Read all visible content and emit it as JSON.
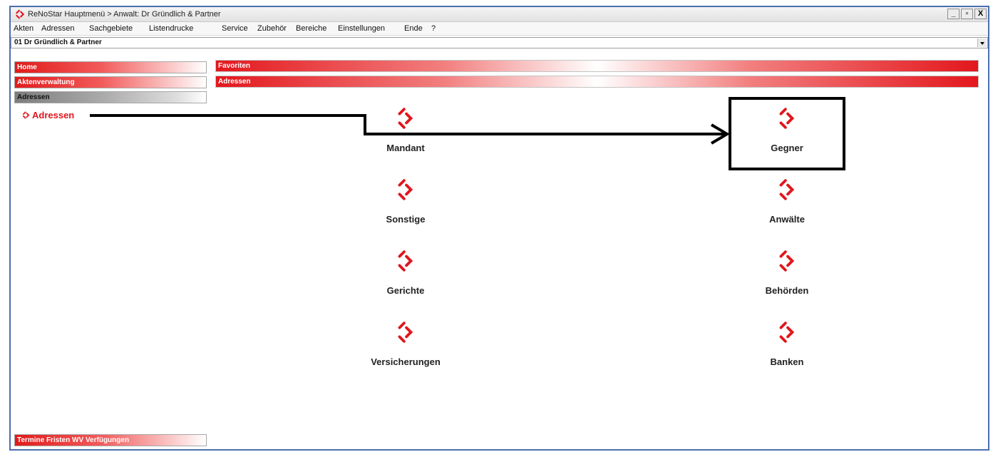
{
  "window": {
    "title": "ReNoStar Hauptmenü > Anwalt: Dr Gründlich & Partner",
    "buttons": [
      "_",
      "▫",
      "X"
    ]
  },
  "menu": [
    "Akten",
    "Adressen",
    "Sachgebiete",
    "Listendrucke",
    "Service",
    "Zubehör",
    "Bereiche",
    "Einstellungen",
    "Ende",
    "?"
  ],
  "selector": {
    "value": "01 Dr Gründlich & Partner"
  },
  "sidebar": {
    "buttons": [
      "Home",
      "Aktenverwaltung",
      "Adressen"
    ],
    "active_link": "Adressen",
    "bottom_button": "Termine Fristen WV Verfügungen"
  },
  "headers": [
    "Favoriten",
    "Adressen"
  ],
  "tiles": {
    "left": [
      "Mandant",
      "Sonstige",
      "Gerichte",
      "Versicherungen"
    ],
    "right": [
      "Gegner",
      "Anwälte",
      "Behörden",
      "Banken"
    ]
  },
  "colors": {
    "brand_red": "#e0161c",
    "window_border": "#4a6fb0"
  },
  "icons": {
    "tile_icon": "renostar-logo-icon",
    "link_icon": "chevron-right-icon"
  }
}
